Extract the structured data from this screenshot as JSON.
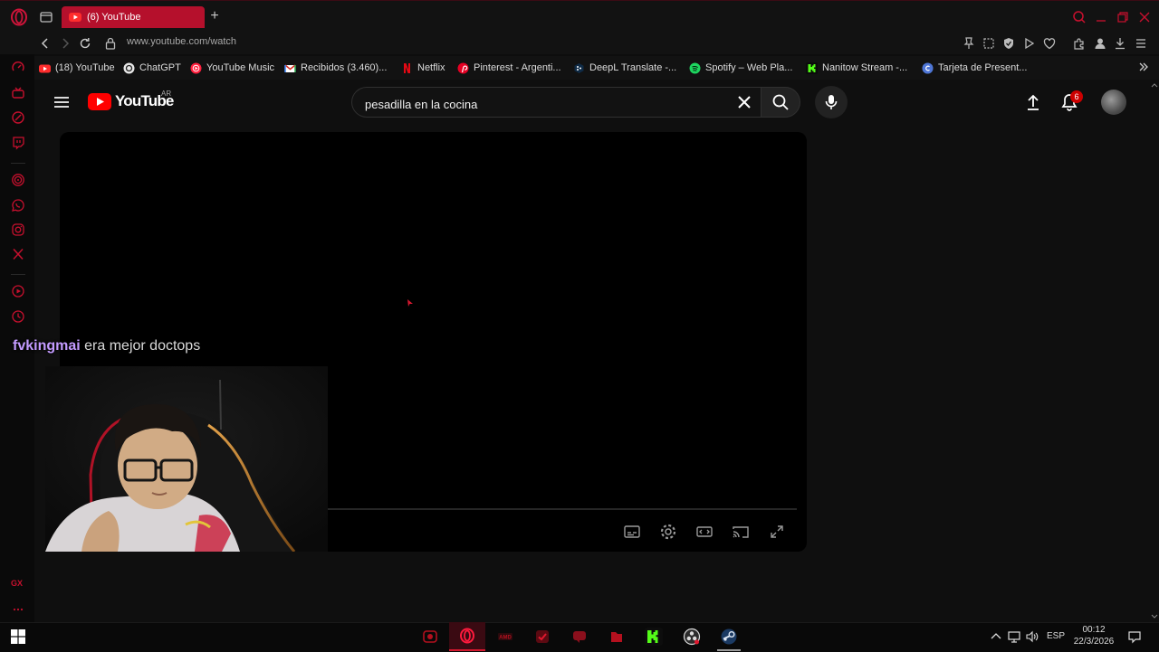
{
  "browser": {
    "tab": {
      "title": "(6) YouTube"
    },
    "address": {
      "url": "www.youtube.com/watch"
    },
    "bookmarks": [
      {
        "label": "(18) YouTube",
        "icon": "youtube-icon"
      },
      {
        "label": "ChatGPT",
        "icon": "chatgpt-icon"
      },
      {
        "label": "YouTube Music",
        "icon": "youtube-music-icon"
      },
      {
        "label": "Recibidos (3.460)...",
        "icon": "gmail-icon"
      },
      {
        "label": "Netflix",
        "icon": "netflix-icon"
      },
      {
        "label": "Pinterest - Argenti...",
        "icon": "pinterest-icon"
      },
      {
        "label": "DeepL Translate -...",
        "icon": "deepl-icon"
      },
      {
        "label": "Spotify – Web Pla...",
        "icon": "spotify-icon"
      },
      {
        "label": "Nanitow Stream -...",
        "icon": "kick-icon"
      },
      {
        "label": "Tarjeta de Present...",
        "icon": "canva-icon"
      }
    ],
    "accent_color": "#b5102c"
  },
  "youtube": {
    "logo_text": "YouTube",
    "country_code": "AR",
    "search": {
      "value": "pesadilla en la cocina"
    },
    "notifications_count": "6"
  },
  "overlay": {
    "chat": {
      "username": "fvkingmai",
      "message": "era mejor doctops"
    }
  },
  "sidebar": {
    "label": "GX"
  },
  "taskbar": {
    "language": "ESP",
    "time": "00:12",
    "date": "22/3/2026"
  }
}
